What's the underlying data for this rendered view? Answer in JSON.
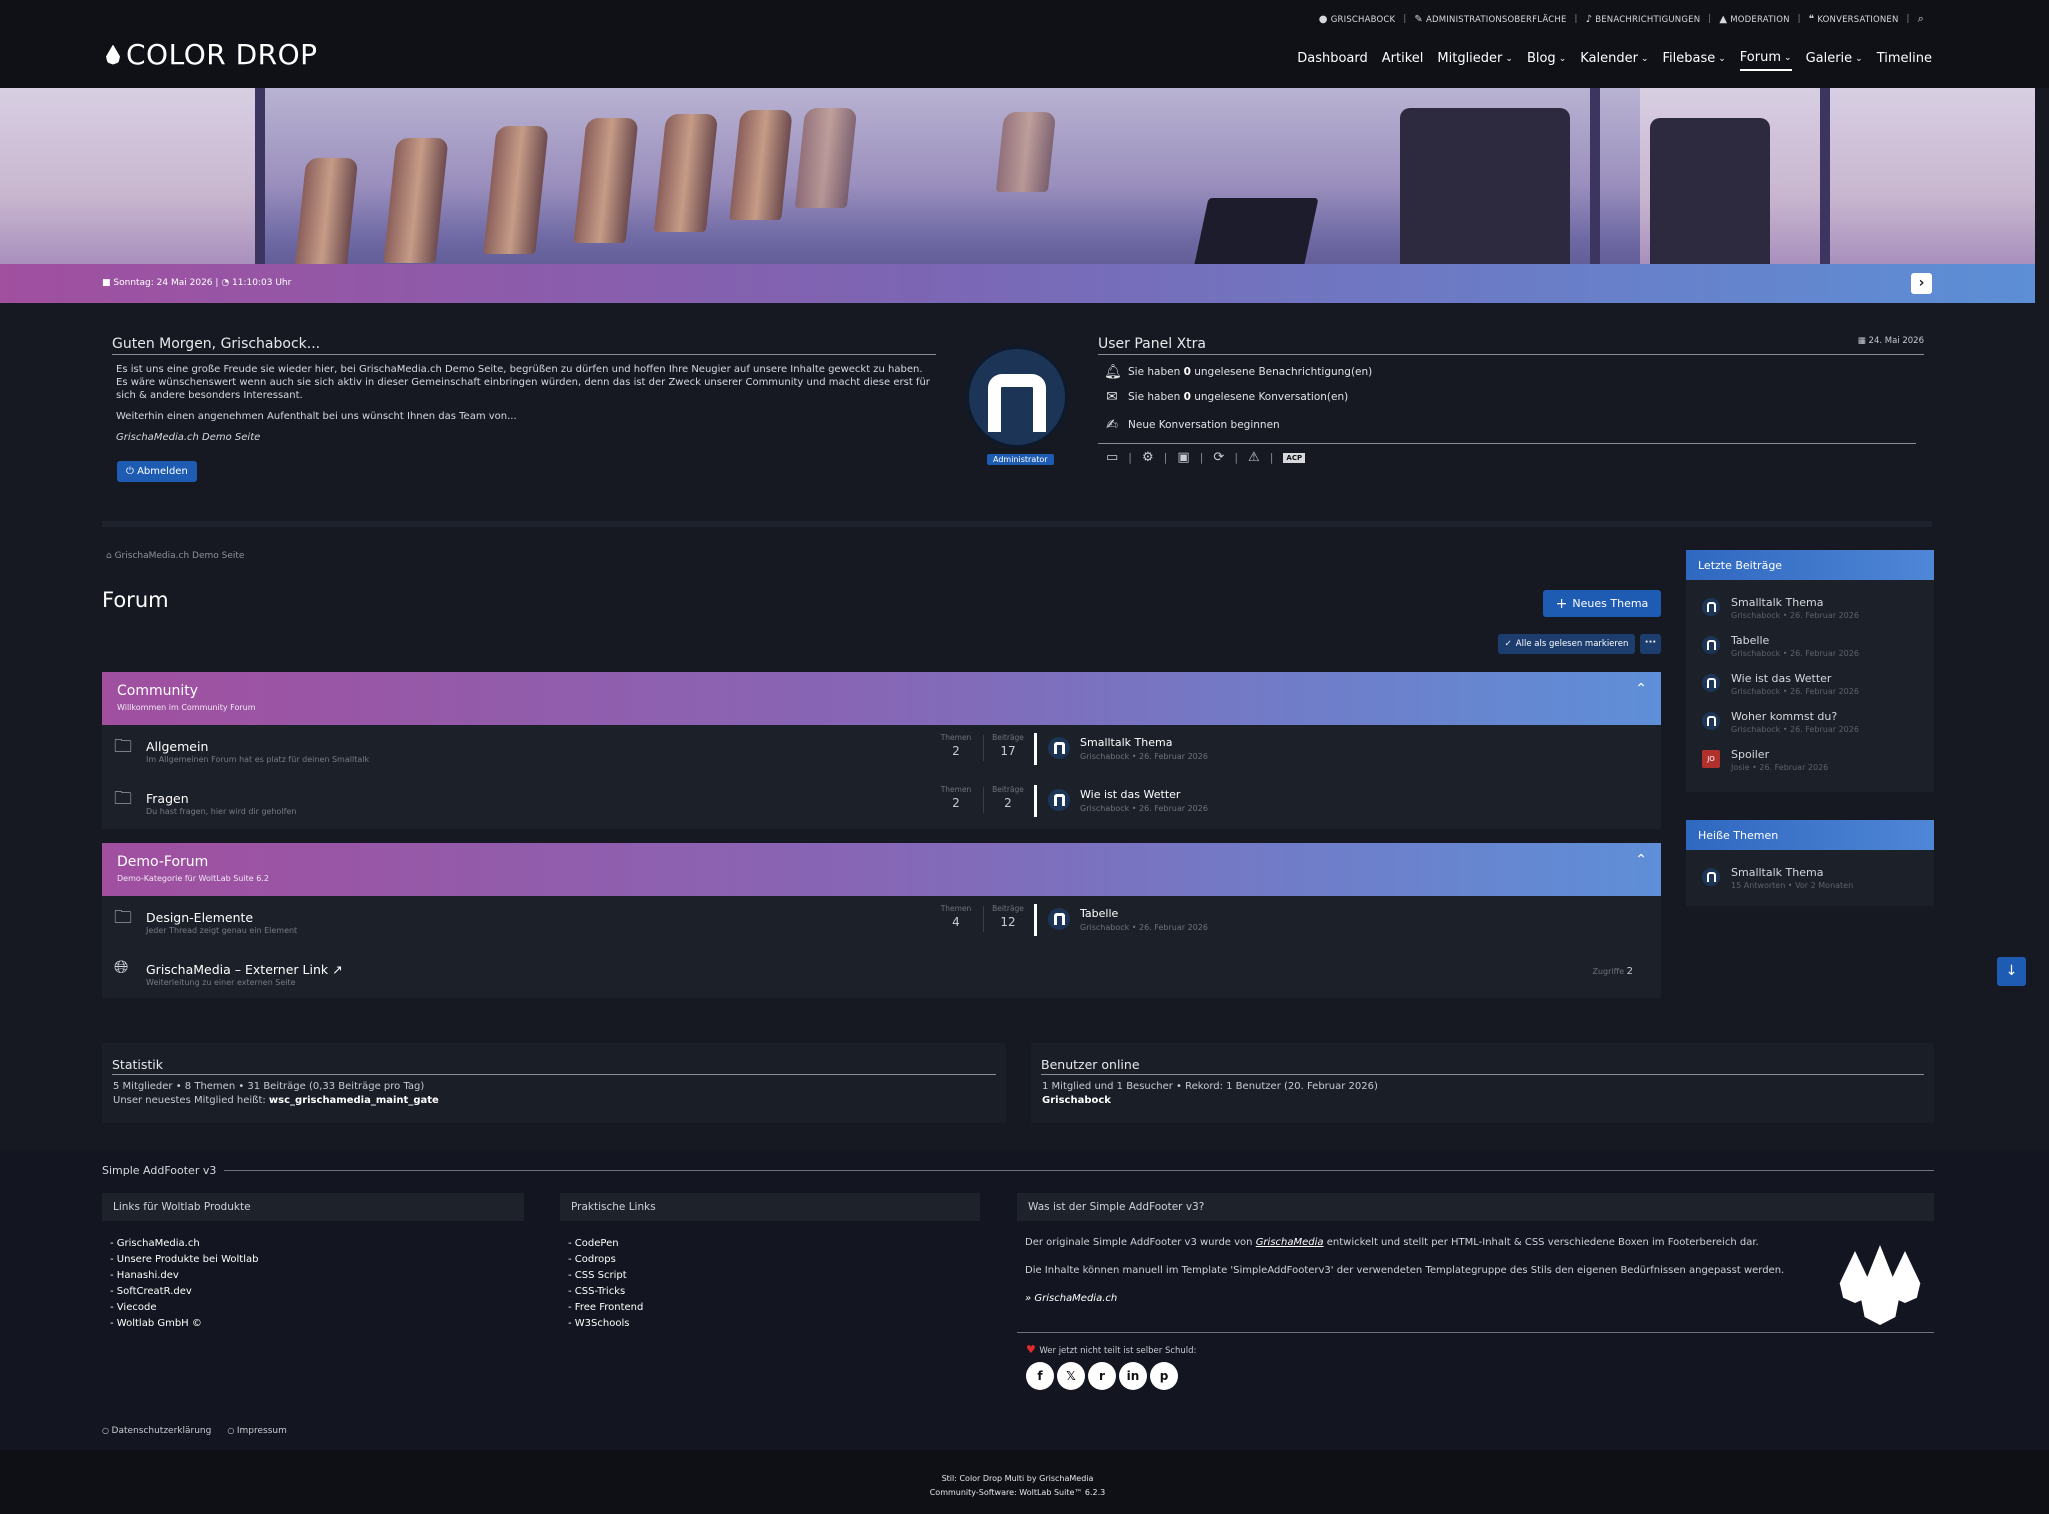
{
  "userbar": {
    "items": [
      {
        "icon": "user-circle-icon",
        "label": "GRISCHABOCK"
      },
      {
        "icon": "wrench-icon",
        "label": "ADMINISTRATIONSOBERFLÄCHE"
      },
      {
        "icon": "bell-icon",
        "label": "BENACHRICHTIGUNGEN"
      },
      {
        "icon": "warning-icon",
        "label": "MODERATION"
      },
      {
        "icon": "comments-icon",
        "label": "KONVERSATIONEN"
      }
    ],
    "search_icon": "search-icon"
  },
  "brand": {
    "logo_text": "COLOR DROP"
  },
  "nav": {
    "items": [
      {
        "label": "Dashboard",
        "dropdown": false
      },
      {
        "label": "Artikel",
        "dropdown": false
      },
      {
        "label": "Mitglieder",
        "dropdown": true
      },
      {
        "label": "Blog",
        "dropdown": true
      },
      {
        "label": "Kalender",
        "dropdown": true
      },
      {
        "label": "Filebase",
        "dropdown": true
      },
      {
        "label": "Forum",
        "dropdown": true,
        "active": true
      },
      {
        "label": "Galerie",
        "dropdown": true
      },
      {
        "label": "Timeline",
        "dropdown": false
      }
    ]
  },
  "hero": {
    "date_text": "Sonntag: 24 Mai 2026",
    "time_text": "11:10:03 Uhr"
  },
  "welcome": {
    "title": "Guten Morgen, Grischabock...",
    "paragraph1": "Es ist uns eine große Freude sie wieder hier, bei GrischaMedia.ch Demo Seite, begrüßen zu dürfen und hoffen Ihre Neugier auf unsere Inhalte geweckt zu haben. Es wäre wünschenswert wenn auch sie sich aktiv in dieser Gemeinschaft einbringen würden, denn das ist der Zweck unserer Community und macht diese erst für sich & andere besonders Interessant.",
    "paragraph2": "Weiterhin einen angenehmen Aufenthalt bei uns wünscht Ihnen das Team von...",
    "signature": "GrischaMedia.ch Demo Seite",
    "logout_label": "Abmelden",
    "avatar_badge": "Administrator"
  },
  "user_panel": {
    "title": "User Panel Xtra",
    "date": "24. Mai 2026",
    "notif_pre": "Sie haben",
    "notif_count": "0",
    "notif_post": "ungelesene Benachrichtigung(en)",
    "conv_pre": "Sie haben",
    "conv_count": "0",
    "conv_post": "ungelesene Konversation(en)",
    "new_conv": "Neue Konversation beginnen",
    "acp_label": "ACP"
  },
  "breadcrumb": {
    "home": "GrischaMedia.ch Demo Seite"
  },
  "forum": {
    "title": "Forum",
    "new_thread": "Neues Thema",
    "mark_read": "Alle als gelesen markieren",
    "stat_threads_label": "Themen",
    "stat_posts_label": "Beiträge",
    "categories": [
      {
        "title": "Community",
        "desc": "Willkommen im Community Forum",
        "boards": [
          {
            "name": "Allgemein",
            "desc": "Im Allgemeinen Forum hat es platz für deinen Smalltalk",
            "threads": "2",
            "posts": "17",
            "last_title": "Smalltalk Thema",
            "last_meta": "Grischabock • 26. Februar 2026"
          },
          {
            "name": "Fragen",
            "desc": "Du hast fragen, hier wird dir geholfen",
            "threads": "2",
            "posts": "2",
            "last_title": "Wie ist das Wetter",
            "last_meta": "Grischabock • 26. Februar 2026"
          }
        ]
      },
      {
        "title": "Demo-Forum",
        "desc": "Demo-Kategorie für WoltLab Suite 6.2",
        "boards": [
          {
            "name": "Design-Elemente",
            "desc": "Jeder Thread zeigt genau ein Element",
            "threads": "4",
            "posts": "12",
            "last_title": "Tabelle",
            "last_meta": "Grischabock • 26. Februar 2026"
          }
        ],
        "link": {
          "name": "GrischaMedia – Externer Link ↗",
          "desc": "Weiterleitung zu einer externen Seite",
          "hits_label": "Zugriffe",
          "hits": "2"
        }
      }
    ]
  },
  "sidebar": {
    "latest_title": "Letzte Beiträge",
    "latest": [
      {
        "title": "Smalltalk Thema",
        "meta": "Grischabock • 26. Februar 2026",
        "avatar": "logo"
      },
      {
        "title": "Tabelle",
        "meta": "Grischabock • 26. Februar 2026",
        "avatar": "logo"
      },
      {
        "title": "Wie ist das Wetter",
        "meta": "Grischabock • 26. Februar 2026",
        "avatar": "logo"
      },
      {
        "title": "Woher kommst du?",
        "meta": "Grischabock • 26. Februar 2026",
        "avatar": "logo"
      },
      {
        "title": "Spoiler",
        "meta": "Josie • 26. Februar 2026",
        "avatar": "JO"
      }
    ],
    "hot_title": "Heiße Themen",
    "hot": [
      {
        "title": "Smalltalk Thema",
        "meta": "15 Antworten • Vor 2 Monaten"
      }
    ]
  },
  "stats": {
    "title": "Statistik",
    "line1": "5 Mitglieder  •  8 Themen  •  31 Beiträge (0,33 Beiträge pro Tag)",
    "line2_pre": "Unser neuestes Mitglied heißt: ",
    "line2_member": "wsc_grischamedia_maint_gate"
  },
  "online": {
    "title": "Benutzer online",
    "line1": "1 Mitglied und 1 Besucher  •  Rekord: 1 Benutzer (20. Februar 2026)",
    "user": "Grischabock"
  },
  "footer": {
    "section_title": "Simple AddFooter v3",
    "col1_title": "Links für Woltlab Produkte",
    "col1_links": [
      "GrischaMedia.ch",
      "Unsere Produkte bei Woltlab",
      "Hanashi.dev",
      "SoftCreatR.dev",
      "Viecode",
      "Woltlab GmbH ©"
    ],
    "col2_title": "Praktische Links",
    "col2_links": [
      "CodePen",
      "Codrops",
      "CSS Script",
      "CSS-Tricks",
      "Free Frontend",
      "W3Schools"
    ],
    "col3_title": "Was ist der Simple AddFooter v3?",
    "info1_pre": "Der originale Simple AddFooter v3 wurde von ",
    "info1_brand": "GrischaMedia",
    "info1_post": " entwickelt und stellt per HTML-Inhalt & CSS verschiedene Boxen im Footerbereich dar.",
    "info2": "Die Inhalte können manuell im Template 'SimpleAddFooterv3' der verwendeten Templategruppe des Stils den eigenen Bedürfnissen angepasst werden.",
    "info_link": "» GrischaMedia.ch",
    "share_text": "Wer jetzt nicht teilt ist selber Schuld:",
    "social": [
      {
        "icon": "facebook-icon",
        "glyph": "f"
      },
      {
        "icon": "x-icon",
        "glyph": "𝕏"
      },
      {
        "icon": "reddit-icon",
        "glyph": "r"
      },
      {
        "icon": "linkedin-icon",
        "glyph": "in"
      },
      {
        "icon": "pinterest-icon",
        "glyph": "p"
      }
    ],
    "legal": [
      "Datenschutzerklärung",
      "Impressum"
    ],
    "credit1": "Stil: Color Drop Multi by GrischaMedia",
    "credit2": "Community-Software: WoltLab Suite™ 6.2.3"
  }
}
